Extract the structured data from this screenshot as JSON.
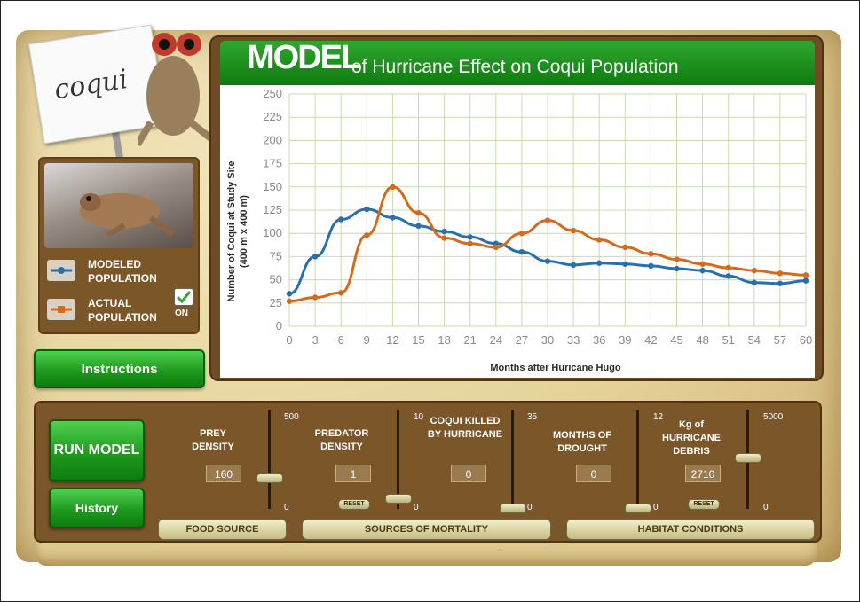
{
  "sign": {
    "text": "coqui"
  },
  "legend": {
    "modeled": "MODELED POPULATION",
    "actual": "ACTUAL POPULATION",
    "on_label": "ON"
  },
  "buttons": {
    "instructions": "Instructions",
    "run_model": "RUN MODEL",
    "history": "History"
  },
  "chart_header": {
    "title_big": "MODEL",
    "title_rest": "of Hurricane Effect on Coqui Population"
  },
  "chart_data": {
    "type": "line",
    "xlabel": "Months after Huricane Hugo",
    "ylabel": "Number of Coqui at Study Site",
    "ylabel_sub": "(400 m x 400 m)",
    "x_ticks": [
      0,
      3,
      6,
      9,
      12,
      15,
      18,
      21,
      24,
      27,
      30,
      33,
      36,
      39,
      42,
      45,
      48,
      51,
      54,
      57,
      60
    ],
    "y_ticks": [
      0,
      25,
      50,
      75,
      100,
      125,
      150,
      175,
      200,
      225,
      250
    ],
    "xlim": [
      0,
      60
    ],
    "ylim": [
      0,
      250
    ],
    "grid": true,
    "series": [
      {
        "name": "MODELED POPULATION",
        "color": "#2a6fad",
        "x": [
          0,
          3,
          6,
          9,
          12,
          15,
          18,
          21,
          24,
          27,
          30,
          33,
          36,
          39,
          42,
          45,
          48,
          51,
          54,
          57,
          60
        ],
        "values": [
          35,
          75,
          115,
          126,
          117,
          108,
          102,
          96,
          89,
          80,
          70,
          66,
          68,
          67,
          65,
          62,
          60,
          54,
          47,
          46,
          49
        ]
      },
      {
        "name": "ACTUAL POPULATION",
        "color": "#d66a1c",
        "x": [
          0,
          3,
          6,
          9,
          12,
          15,
          18,
          21,
          24,
          27,
          30,
          33,
          36,
          39,
          42,
          45,
          48,
          51,
          54,
          57,
          60
        ],
        "values": [
          27,
          31,
          36,
          98,
          150,
          122,
          95,
          89,
          85,
          100,
          114,
          103,
          93,
          85,
          78,
          72,
          67,
          63,
          60,
          57,
          55
        ]
      }
    ]
  },
  "controls": {
    "prey": {
      "label": "PREY DENSITY",
      "value": "160",
      "max": "500",
      "min": "0",
      "level": 0.32
    },
    "predator": {
      "label": "PREDATOR DENSITY",
      "value": "1",
      "max": "10",
      "min": "0",
      "reset": "RESET",
      "level": 0.1
    },
    "killed": {
      "label": "COQUI KILLED BY HURRICANE",
      "value": "0",
      "max": "35",
      "min": "0",
      "level": 0.0
    },
    "drought": {
      "label": "MONTHS OF DROUGHT",
      "value": "0",
      "max": "12",
      "min": "0",
      "level": 0.0
    },
    "debris": {
      "label": "Kg of HURRICANE DEBRIS",
      "value": "2710",
      "max": "5000",
      "min": "0",
      "reset": "RESET",
      "level": 0.54
    }
  },
  "sections": {
    "food": "FOOD SOURCE",
    "mortality": "SOURCES OF MORTALITY",
    "habitat": "HABITAT CONDITIONS"
  }
}
